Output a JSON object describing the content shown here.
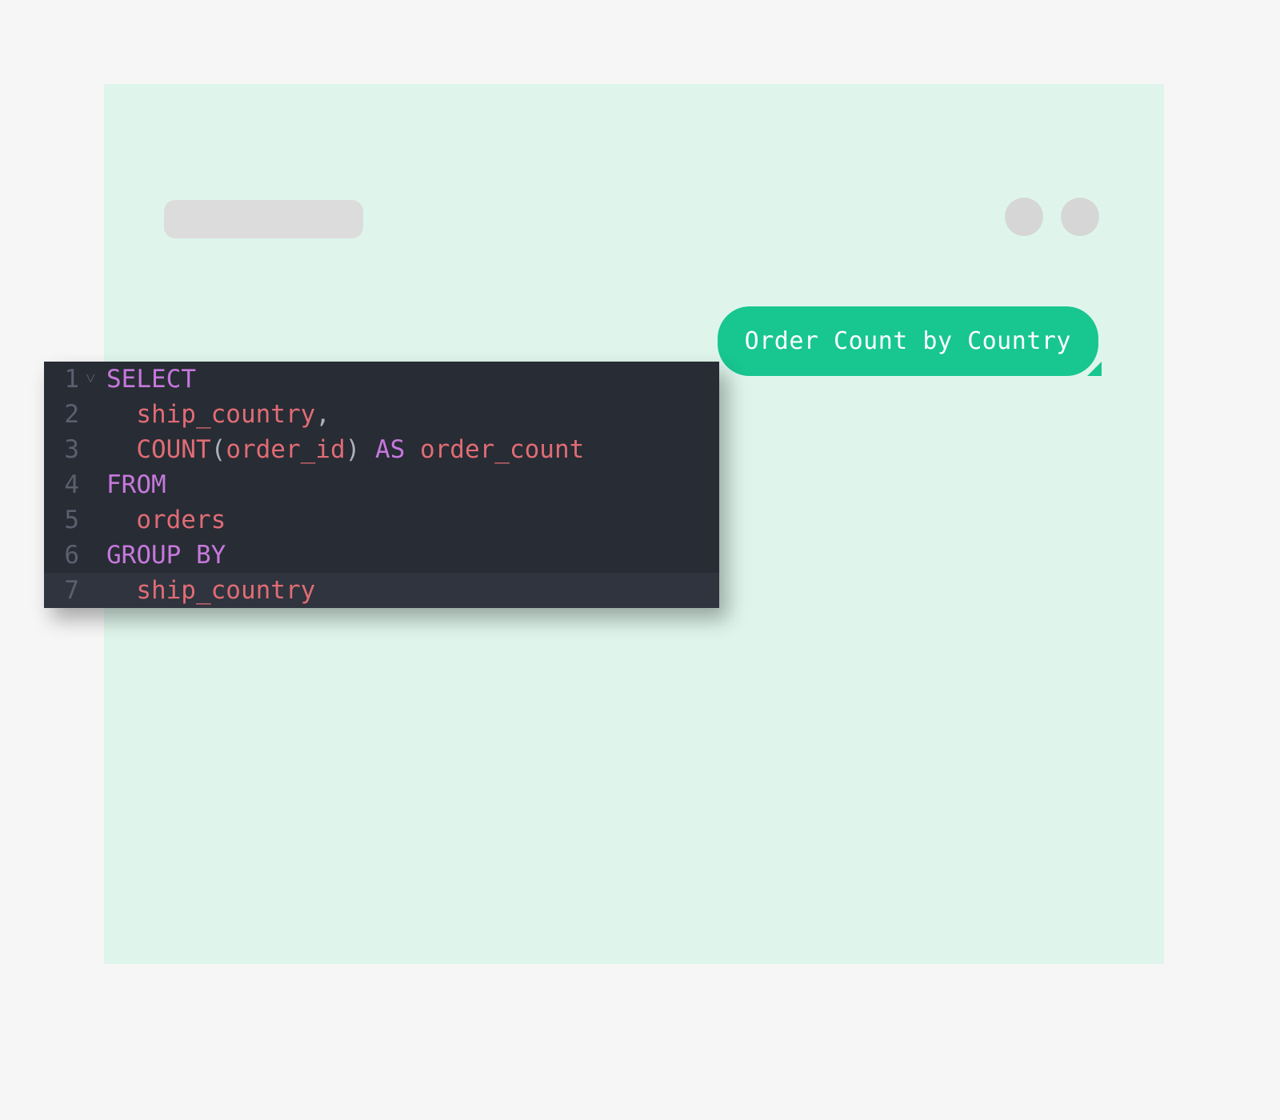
{
  "chat": {
    "user_message": "Order Count by Country"
  },
  "code": {
    "lines": [
      {
        "num": "1",
        "fold": "˅",
        "tokens": [
          {
            "t": "SELECT",
            "c": "tok-kw"
          }
        ]
      },
      {
        "num": "2",
        "fold": "",
        "indent": 2,
        "tokens": [
          {
            "t": "ship_country",
            "c": "tok-id"
          },
          {
            "t": ",",
            "c": "tok-pn"
          }
        ]
      },
      {
        "num": "3",
        "fold": "",
        "indent": 2,
        "tokens": [
          {
            "t": "COUNT",
            "c": "tok-id"
          },
          {
            "t": "(",
            "c": "tok-pn"
          },
          {
            "t": "order_id",
            "c": "tok-id"
          },
          {
            "t": ")",
            "c": "tok-pn"
          },
          {
            "t": " ",
            "c": "tok-pn"
          },
          {
            "t": "AS",
            "c": "tok-kw"
          },
          {
            "t": " ",
            "c": "tok-pn"
          },
          {
            "t": "order_count",
            "c": "tok-id"
          }
        ]
      },
      {
        "num": "4",
        "fold": "",
        "tokens": [
          {
            "t": "FROM",
            "c": "tok-kw"
          }
        ]
      },
      {
        "num": "5",
        "fold": "",
        "indent": 2,
        "tokens": [
          {
            "t": "orders",
            "c": "tok-id"
          }
        ]
      },
      {
        "num": "6",
        "fold": "",
        "tokens": [
          {
            "t": "GROUP",
            "c": "tok-kw"
          },
          {
            "t": " ",
            "c": "tok-pn"
          },
          {
            "t": "BY",
            "c": "tok-kw"
          }
        ]
      },
      {
        "num": "7",
        "fold": "",
        "indent": 2,
        "current": true,
        "tokens": [
          {
            "t": "ship_country",
            "c": "tok-id"
          }
        ]
      }
    ]
  }
}
